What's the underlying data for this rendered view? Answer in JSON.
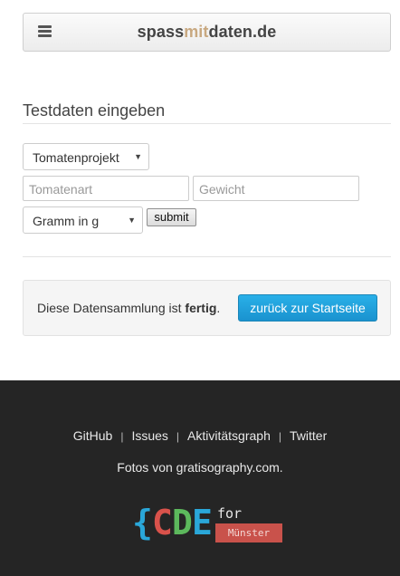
{
  "navbar": {
    "brand_left": "spass",
    "brand_mid": "mit",
    "brand_right": "daten.de",
    "menu_icon": "hamburger-icon"
  },
  "form": {
    "heading": "Testdaten eingeben",
    "project_select": "Tomatenprojekt",
    "variety_placeholder": "Tomatenart",
    "weight_placeholder": "Gewicht",
    "unit_select": "Gramm in g",
    "submit_label": "submit"
  },
  "alert": {
    "text_before": "Diese Datensammlung ist ",
    "text_bold": "fertig",
    "text_after": ".",
    "button_label": "zurück zur Startseite"
  },
  "footer": {
    "links": [
      "GitHub",
      "Issues",
      "Aktivitätsgraph",
      "Twitter"
    ],
    "separator": "|",
    "credit": "Fotos von gratisography.com.",
    "logo": {
      "glyphs": [
        "{",
        "C",
        "D",
        "E"
      ],
      "for_label": "for",
      "city_label": "Münster"
    }
  },
  "colors": {
    "primary_button": "#1a92cf",
    "footer_bg": "#252525",
    "logo_brace": "#2aa7d9",
    "logo_c": "#d9524b",
    "logo_d": "#5cb85c",
    "logo_e": "#2aa7d9",
    "logo_badge": "#c9524b"
  }
}
